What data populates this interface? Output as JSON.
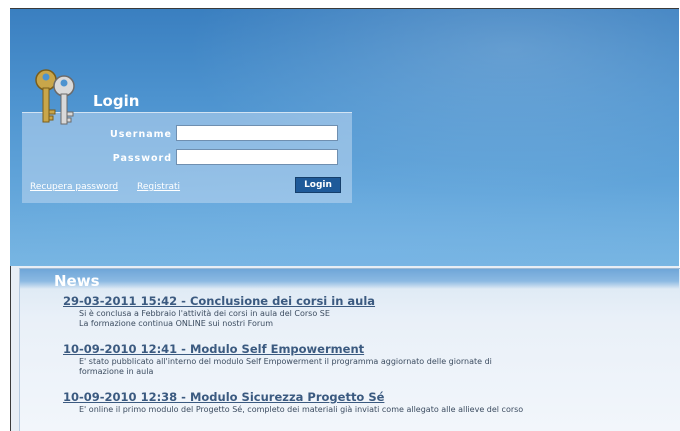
{
  "login": {
    "title": "Login",
    "username_label": "Username",
    "password_label": "Password",
    "username_value": "",
    "password_value": "",
    "recover_link": "Recupera password",
    "register_link": "Registrati",
    "submit_label": "Login"
  },
  "news": {
    "title": "News",
    "items": [
      {
        "title": "29-03-2011 15:42 - Conclusione dei corsi in aula",
        "lines": [
          "Si è conclusa a Febbraio l'attività dei corsi in aula del Corso SE",
          "La formazione continua ONLINE sui nostri Forum"
        ]
      },
      {
        "title": "10-09-2010 12:41 - Modulo Self Empowerment",
        "lines": [
          "E' stato pubblicato all'interno del modulo Self Empowerment il programma aggiornato delle giornate di",
          "formazione in aula"
        ]
      },
      {
        "title": "10-09-2010 12:38 - Modulo Sicurezza Progetto Sé",
        "lines": [
          "E' online il primo modulo del Progetto Sé, completo dei materiali  già inviati come allegato alle allieve del corso"
        ]
      }
    ]
  },
  "icons": {
    "login": "keys-icon"
  }
}
